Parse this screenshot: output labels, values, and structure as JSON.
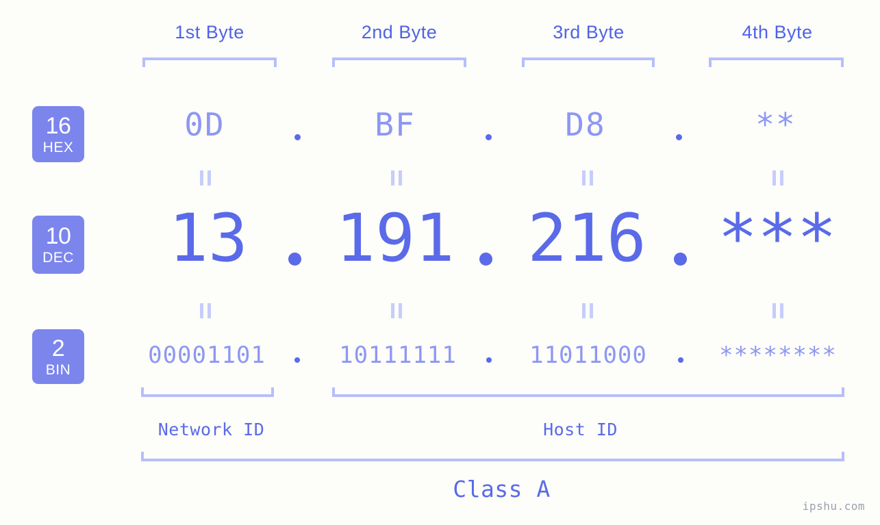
{
  "background_color": "#fdfdfa",
  "accent_color": "#5a6ae8",
  "accent_light_color": "#8d97f2",
  "bracket_color": "#b6bffb",
  "badge_color": "#7b85ec",
  "headers": {
    "byte1": "1st Byte",
    "byte2": "2nd Byte",
    "byte3": "3rd Byte",
    "byte4": "4th Byte"
  },
  "bases": [
    {
      "number": "16",
      "name": "HEX"
    },
    {
      "number": "10",
      "name": "DEC"
    },
    {
      "number": "2",
      "name": "BIN"
    }
  ],
  "rows": {
    "hex": {
      "base_number": "16",
      "base_name": "HEX",
      "octets": [
        "0D",
        "BF",
        "D8",
        "**"
      ],
      "separator": "."
    },
    "dec": {
      "base_number": "10",
      "base_name": "DEC",
      "octets": [
        "13",
        "191",
        "216",
        "***"
      ],
      "separator": "."
    },
    "bin": {
      "base_number": "2",
      "base_name": "BIN",
      "octets": [
        "00001101",
        "10111111",
        "11011000",
        "********"
      ],
      "separator": "."
    }
  },
  "equals_symbol": "||",
  "sections": {
    "network_id": "Network ID",
    "host_id": "Host ID",
    "class": "Class A"
  },
  "watermark": "ipshu.com"
}
